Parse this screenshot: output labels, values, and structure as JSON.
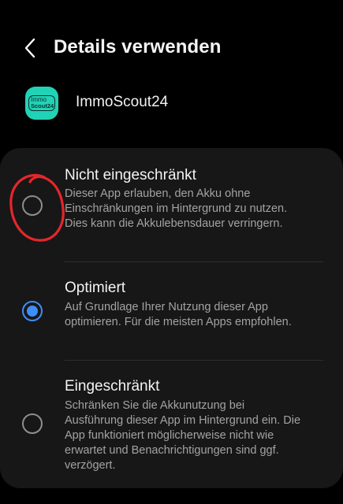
{
  "header": {
    "title": "Details verwenden",
    "back_icon": "chevron-left-icon"
  },
  "app": {
    "name": "ImmoScout24",
    "icon_line1": "Immo",
    "icon_line2": "Scout24",
    "icon_color": "#21d3b6"
  },
  "options": [
    {
      "title": "Nicht eingeschränkt",
      "description": "Dieser App erlauben, den Akku ohne Einschränkungen im Hintergrund zu nutzen. Dies kann die Akkulebensdauer verringern.",
      "selected": false
    },
    {
      "title": "Optimiert",
      "description": "Auf Grundlage Ihrer Nutzung dieser App optimieren. Für die meisten Apps empfohlen.",
      "selected": true
    },
    {
      "title": "Eingeschränkt",
      "description": "Schränken Sie die Akkunutzung bei Ausführung dieser App im Hintergrund ein. Die App funktioniert möglicherweise nicht wie erwartet und Benachrichtigungen sind ggf. verzögert.",
      "selected": false
    }
  ],
  "colors": {
    "accent": "#3e8ef7",
    "annotation": "#e5262b",
    "card_bg": "#171717"
  }
}
